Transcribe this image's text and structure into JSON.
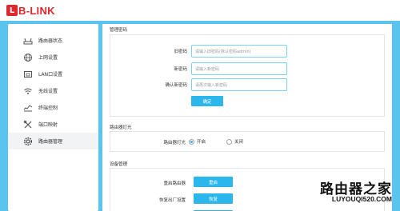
{
  "brand": {
    "logo_mark": "L",
    "logo_text": "B-LINK",
    "brand_color": "#e1262d"
  },
  "sidebar": {
    "items": [
      {
        "label": "路由器状态",
        "icon": "router-status-icon"
      },
      {
        "label": "上网设置",
        "icon": "globe-icon"
      },
      {
        "label": "LAN口设置",
        "icon": "lan-port-icon"
      },
      {
        "label": "无线设置",
        "icon": "wifi-icon"
      },
      {
        "label": "终端控制",
        "icon": "devices-icon"
      },
      {
        "label": "端口映射",
        "icon": "tools-icon"
      },
      {
        "label": "路由器管理",
        "icon": "gear-icon",
        "active": true
      }
    ]
  },
  "password_section": {
    "title": "管理密码",
    "old_label": "旧密码",
    "old_placeholder": "请输入旧密码(默认密码admin)",
    "new_label": "新密码",
    "new_placeholder": "请输入新密码",
    "confirm_label": "确认新密码",
    "confirm_placeholder": "请再次输入新密码",
    "confirm_button": "确定"
  },
  "light_section": {
    "title": "路由器灯光",
    "label": "路由器灯光",
    "on_label": "开启",
    "off_label": "关闭",
    "selected": "开启"
  },
  "device_section": {
    "title": "设备管理",
    "restart_label": "重启路由器",
    "restart_button": "重启",
    "reset_label": "恢复出厂设置",
    "reset_button": "恢复"
  },
  "watermark": {
    "cn": "路由器之家",
    "url": "LUYOUQI520.COM"
  },
  "colors": {
    "accent": "#2bb6ec",
    "background": "#5bc4ee",
    "input_border": "#7ad3f6"
  }
}
